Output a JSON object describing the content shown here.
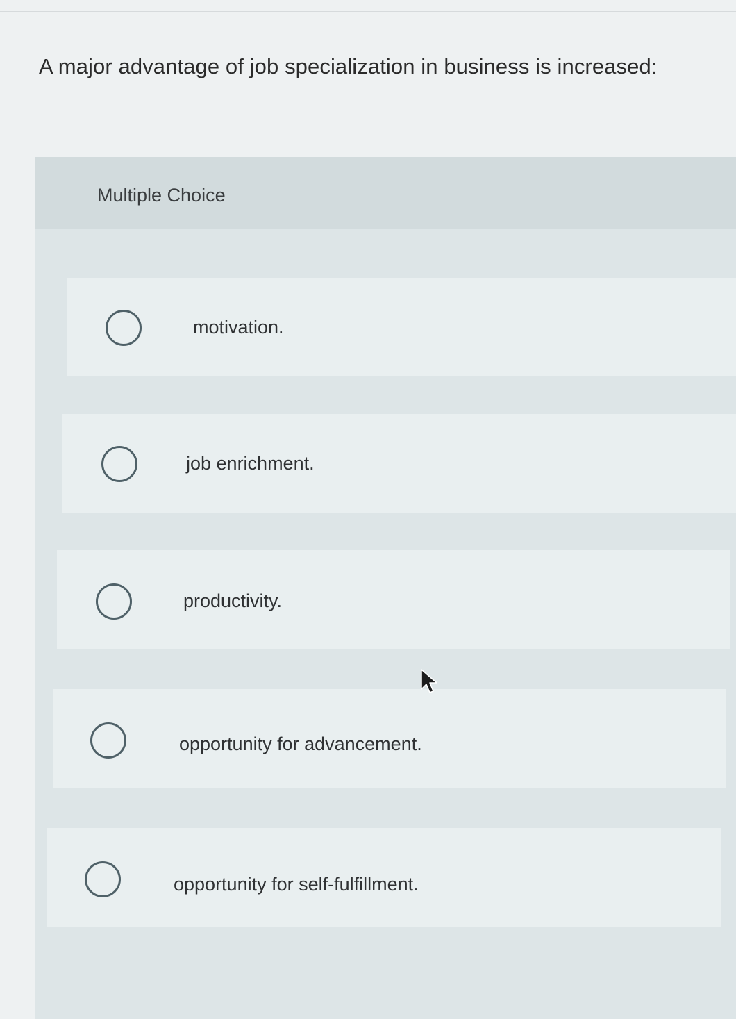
{
  "question": {
    "text": "A major advantage of job specialization in business is increased:"
  },
  "choice_block": {
    "header_label": "Multiple Choice"
  },
  "options": [
    {
      "label": "motivation.",
      "selected": false
    },
    {
      "label": "job enrichment.",
      "selected": false
    },
    {
      "label": "productivity.",
      "selected": false
    },
    {
      "label": "opportunity for advancement.",
      "selected": false
    },
    {
      "label": "opportunity for self-fulfillment.",
      "selected": false
    }
  ],
  "icons": {
    "radio": "radio-unchecked-icon",
    "pointer": "mouse-pointer-icon"
  },
  "colors": {
    "page_background": "#eef1f2",
    "panel_background": "#dde5e7",
    "header_background": "#d2dbdd",
    "option_background": "#e9eff0",
    "radio_border": "#4f6168",
    "text": "#2c2c2c"
  }
}
